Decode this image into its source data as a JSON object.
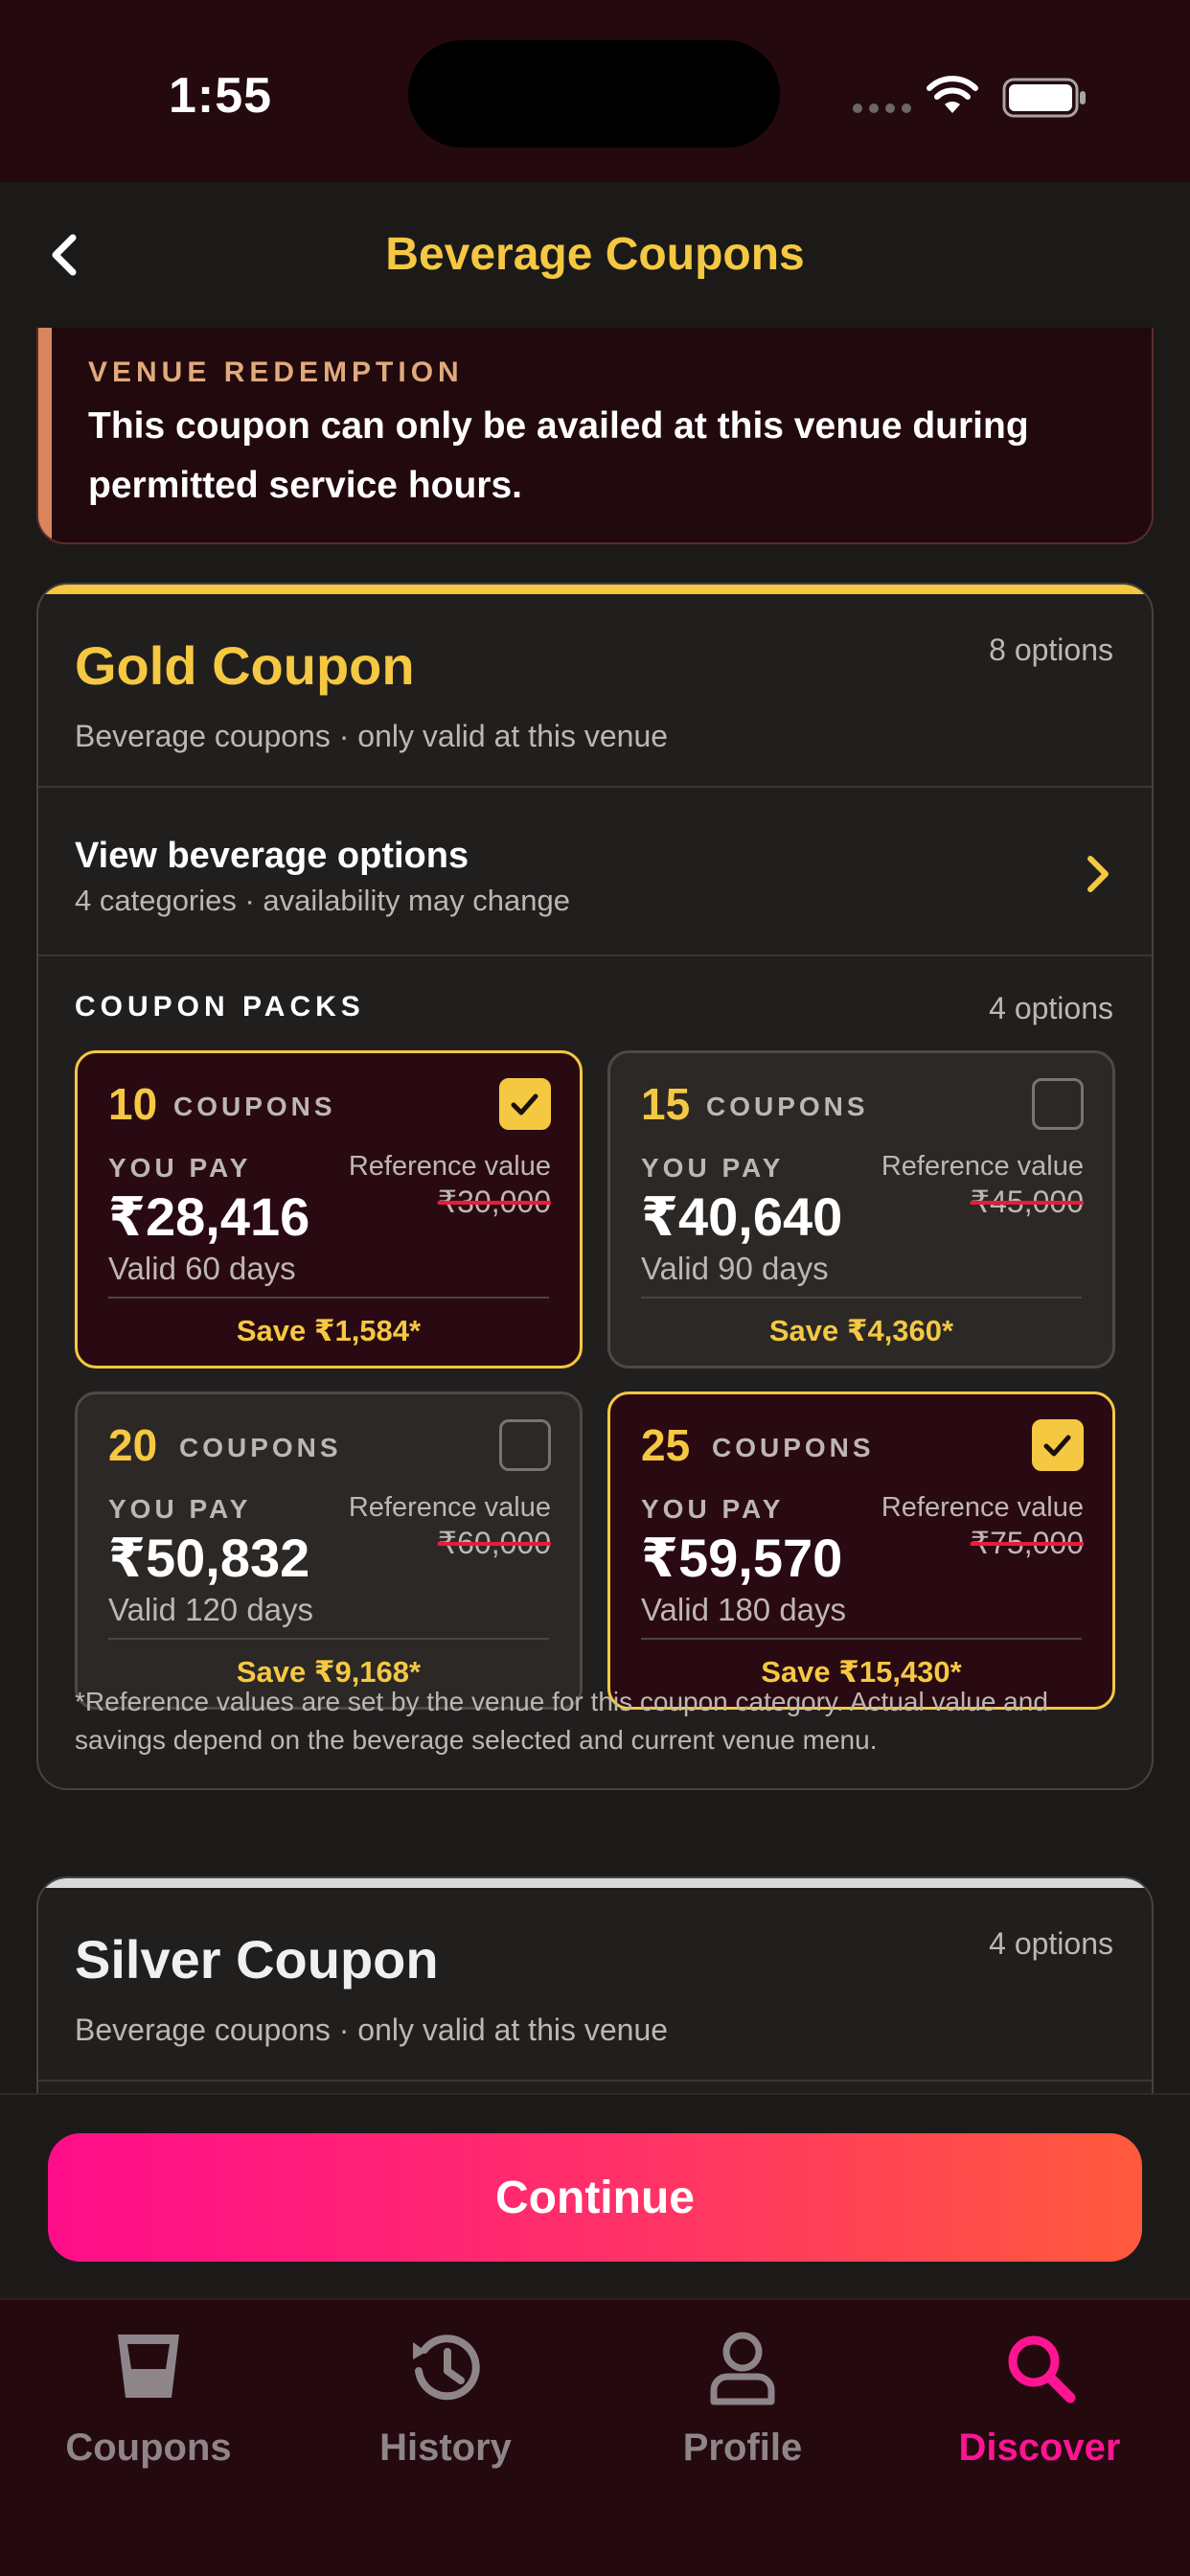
{
  "status_bar": {
    "time": "1:55"
  },
  "header": {
    "title": "Beverage Coupons"
  },
  "notice": {
    "label": "VENUE REDEMPTION",
    "text": "This coupon can only be availed at this venue during permitted service hours."
  },
  "gold": {
    "title": "Gold Coupon",
    "options": "8 options",
    "subtitle": "Beverage coupons · only valid at this venue",
    "bev_title": "View beverage options",
    "bev_sub": "4 categories · availability may change",
    "packs_label": "COUPON PACKS",
    "packs_options": "4 options",
    "packs": [
      {
        "count": "10",
        "unit": "COUPONS",
        "you_pay": "YOU PAY",
        "ref_label": "Reference value",
        "price": "₹28,416",
        "ref_value": "₹30,000",
        "valid": "Valid 60 days",
        "save": "Save ₹1,584*",
        "selected": true
      },
      {
        "count": "15",
        "unit": "COUPONS",
        "you_pay": "YOU PAY",
        "ref_label": "Reference value",
        "price": "₹40,640",
        "ref_value": "₹45,000",
        "valid": "Valid 90 days",
        "save": "Save ₹4,360*",
        "selected": false
      },
      {
        "count": "20",
        "unit": "COUPONS",
        "you_pay": "YOU PAY",
        "ref_label": "Reference value",
        "price": "₹50,832",
        "ref_value": "₹60,000",
        "valid": "Valid 120 days",
        "save": "Save ₹9,168*",
        "selected": false
      },
      {
        "count": "25",
        "unit": "COUPONS",
        "you_pay": "YOU PAY",
        "ref_label": "Reference value",
        "price": "₹59,570",
        "ref_value": "₹75,000",
        "valid": "Valid 180 days",
        "save": "Save ₹15,430*",
        "selected": true
      }
    ],
    "footnote": "*Reference values are set by the venue for this coupon category. Actual value and savings depend on the beverage selected and current venue menu."
  },
  "silver": {
    "title": "Silver Coupon",
    "options": "4 options",
    "subtitle": "Beverage coupons · only valid at this venue"
  },
  "continue_label": "Continue",
  "tabs": [
    {
      "label": "Coupons",
      "icon": "glass-icon",
      "active": false
    },
    {
      "label": "History",
      "icon": "history-icon",
      "active": false
    },
    {
      "label": "Profile",
      "icon": "person-icon",
      "active": false
    },
    {
      "label": "Discover",
      "icon": "search-icon",
      "active": true
    }
  ],
  "colors": {
    "accent_gold": "#f5c842",
    "accent_pink": "#ff1493",
    "background": "#1c1a19",
    "bar_background": "#24090f",
    "strike_red": "#e81c3a"
  }
}
